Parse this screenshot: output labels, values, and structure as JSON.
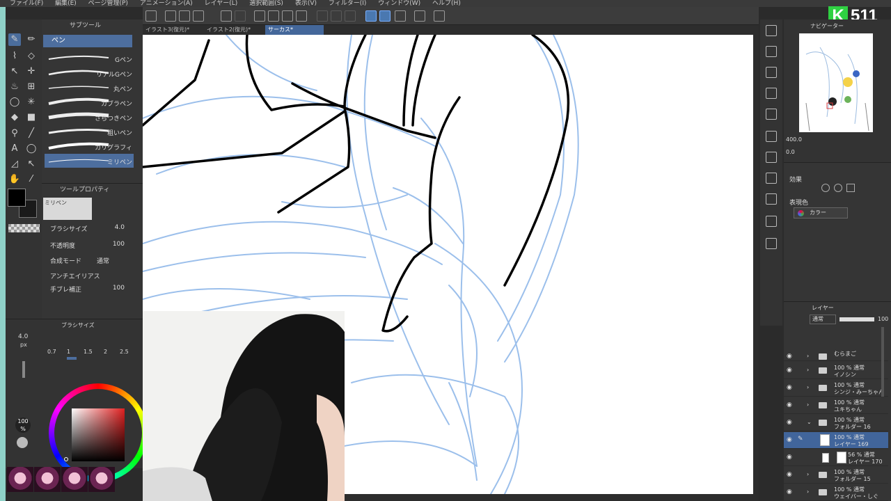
{
  "menu": {
    "items": [
      "ファイル(F)",
      "編集(E)",
      "ページ管理(P)",
      "アニメーション(A)",
      "レイヤー(L)",
      "選択範囲(S)",
      "表示(V)",
      "フィルター(I)",
      "ウィンドウ(W)",
      "ヘルプ(H)"
    ]
  },
  "logo": {
    "letter": "K",
    "number": "511"
  },
  "tabs": [
    {
      "label": "イラスト3(復元)*"
    },
    {
      "label": "イラスト2(復元)*"
    },
    {
      "label": "サーカス*"
    }
  ],
  "subtool": {
    "header": "サブツール",
    "category": "ペン",
    "brushes": [
      "Gペン",
      "リアルGペン",
      "丸ペン",
      "カブラペン",
      "さらつきペン",
      "粗いペン",
      "カリグラフィ",
      "ミリペン"
    ]
  },
  "toolprop": {
    "header": "ツールプロパティ",
    "tool_name": "ミリペン",
    "brush_size_label": "ブラシサイズ",
    "brush_size": "4.0",
    "opacity_label": "不透明度",
    "opacity": "100",
    "blend_label": "合成モード",
    "blend": "通常",
    "antialias_label": "アンチエイリアス",
    "stabilize_label": "手ブレ補正",
    "stabilize": "100"
  },
  "brushsize": {
    "header": "ブラシサイズ",
    "current": "4.0",
    "unit": "px",
    "presets": [
      "0.7",
      "1",
      "1.5",
      "2",
      "2.5"
    ]
  },
  "color": {
    "opacity": "100",
    "percent": "%"
  },
  "navigator": {
    "header": "ナビゲーター",
    "zoom": "400.0",
    "rotation": "0.0"
  },
  "effects": {
    "title": "効果",
    "expression_label": "表現色",
    "expression_value": "カラー"
  },
  "layers": {
    "header": "レイヤー",
    "blend": "通常",
    "opacity": "100",
    "rows": [
      {
        "line1": "",
        "line2": "むらまご",
        "type": "folder",
        "selected": false
      },
      {
        "line1": "100 % 通常",
        "line2": "イノシン",
        "type": "folder",
        "selected": false
      },
      {
        "line1": "100 % 通常",
        "line2": "シンジ・みーちゃん",
        "type": "folder",
        "selected": false
      },
      {
        "line1": "100 % 通常",
        "line2": "ユキちゃん",
        "type": "folder",
        "selected": false
      },
      {
        "line1": "100 % 通常",
        "line2": "フォルダー 16",
        "type": "folder-open",
        "selected": false
      },
      {
        "line1": "100 % 通常",
        "line2": "レイヤー 169",
        "type": "layer",
        "selected": true
      },
      {
        "line1": "56 % 通常",
        "line2": "レイヤー 170",
        "type": "layer",
        "selected": false
      },
      {
        "line1": "100 % 通常",
        "line2": "フォルダー 15",
        "type": "folder",
        "selected": false
      },
      {
        "line1": "100 % 通常",
        "line2": "ウェイバー・しぐ",
        "type": "folder",
        "selected": false
      }
    ]
  },
  "colors": {
    "accent": "#4d6e9e",
    "sketch": "#8ab4e8",
    "logo_green": "#2fd142"
  }
}
